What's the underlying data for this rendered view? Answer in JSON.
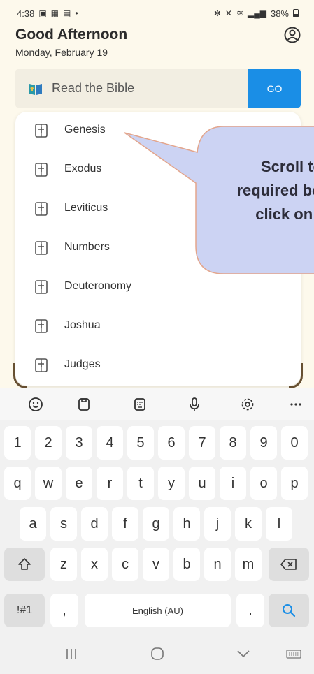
{
  "status_bar": {
    "time": "4:38",
    "battery": "38%"
  },
  "header": {
    "greeting": "Good Afternoon",
    "date": "Monday, February 19"
  },
  "search": {
    "placeholder": "Read the Bible",
    "go_label": "GO"
  },
  "books": [
    "Genesis",
    "Exodus",
    "Leviticus",
    "Numbers",
    "Deuteronomy",
    "Joshua",
    "Judges"
  ],
  "tooltip": {
    "line1": "Scroll to",
    "line2": "required bo",
    "line3": "click on b",
    "fill": "#ccd3f3",
    "border": "#e3a58c"
  },
  "keyboard": {
    "row_numbers": [
      "1",
      "2",
      "3",
      "4",
      "5",
      "6",
      "7",
      "8",
      "9",
      "0"
    ],
    "row_top": [
      "q",
      "w",
      "e",
      "r",
      "t",
      "y",
      "u",
      "i",
      "o",
      "p"
    ],
    "row_middle": [
      "a",
      "s",
      "d",
      "f",
      "g",
      "h",
      "j",
      "k",
      "l"
    ],
    "row_bottom": [
      "z",
      "x",
      "c",
      "v",
      "b",
      "n",
      "m"
    ],
    "symbols_label": "!#1",
    "comma": ",",
    "space_label": "English (AU)",
    "period": ".",
    "accent": "#1a8ee6"
  }
}
